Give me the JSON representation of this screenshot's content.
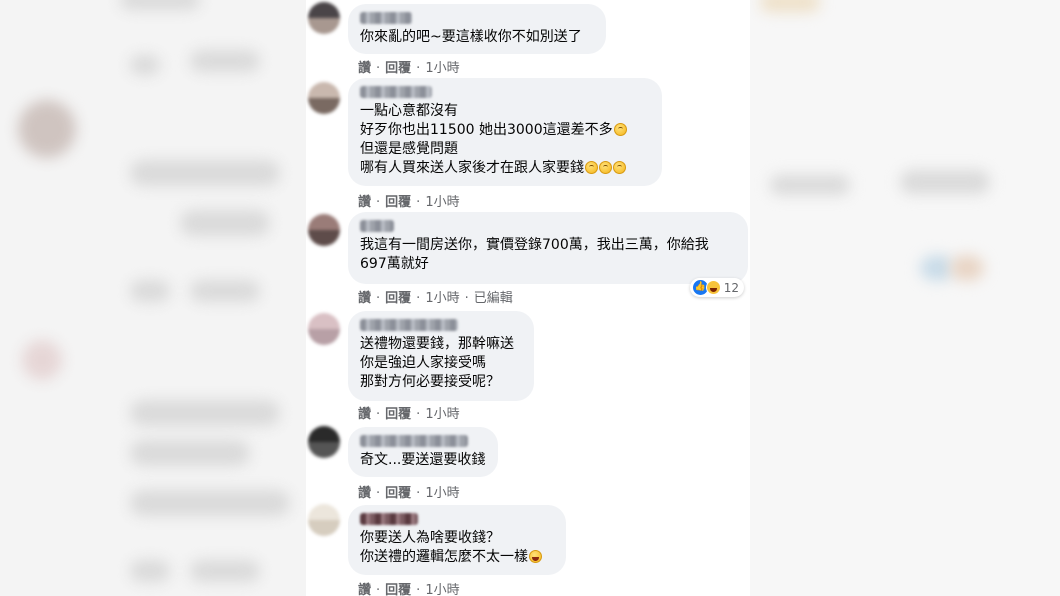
{
  "comments": [
    {
      "lines": [
        "你來亂的吧~要這樣收你不如別送了"
      ],
      "actions": {
        "like": "讚",
        "reply": "回覆",
        "time": "1小時"
      }
    },
    {
      "lines": [
        "一點心意都沒有",
        "好歹你也出11500 她出3000這還差不多",
        "但還是感覺問題",
        "哪有人買來送人家後才在跟人家要錢"
      ],
      "actions": {
        "like": "讚",
        "reply": "回覆",
        "time": "1小時"
      }
    },
    {
      "lines": [
        "我這有一間房送你，實價登錄700萬，我出三萬，你給我",
        "697萬就好"
      ],
      "actions": {
        "like": "讚",
        "reply": "回覆",
        "time": "1小時",
        "edited": "已編輯"
      },
      "reactions": {
        "icons": [
          "like-icon",
          "haha-icon"
        ],
        "count": "12"
      }
    },
    {
      "lines": [
        "送禮物還要錢，那幹嘛送",
        "你是強迫人家接受嗎",
        "那對方何必要接受呢？"
      ],
      "actions": {
        "like": "讚",
        "reply": "回覆",
        "time": "1小時"
      }
    },
    {
      "lines": [
        "奇文...要送還要收錢"
      ],
      "actions": {
        "like": "讚",
        "reply": "回覆",
        "time": "1小時"
      }
    },
    {
      "lines": [
        "你要送人為啥要收錢？",
        "你送禮的邏輯怎麼不太一樣"
      ],
      "actions": {
        "like": "讚",
        "reply": "回覆",
        "time": "1小時"
      }
    }
  ],
  "emoji": {
    "eyeroll": "rolling-eyes-emoji",
    "laugh": "grinning-squinting-emoji"
  },
  "colors": {
    "bubble": "#f0f2f5",
    "meta_text": "#65676b",
    "like_blue": "#1877f2"
  }
}
